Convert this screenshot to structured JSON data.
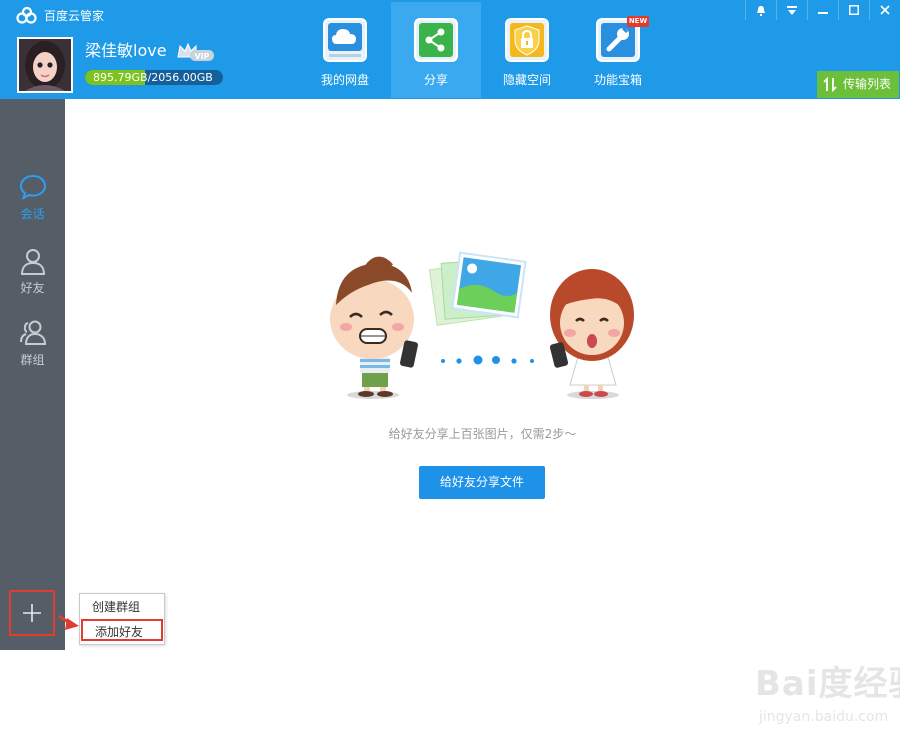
{
  "app": {
    "title": "百度云管家"
  },
  "user": {
    "name": "梁佳敏love",
    "quota_used": "895.79GB",
    "quota_total": "/2056.00GB",
    "quota_fraction": 0.4357
  },
  "nav": {
    "tabs": [
      {
        "label": "我的网盘",
        "icon": "cloud-drive-icon"
      },
      {
        "label": "分享",
        "icon": "share-icon",
        "active": true
      },
      {
        "label": "隐藏空间",
        "icon": "lock-icon"
      },
      {
        "label": "功能宝箱",
        "icon": "toolbox-icon",
        "badge": "NEW"
      }
    ],
    "transfer_label": "传输列表"
  },
  "sidebar": {
    "items": [
      {
        "label": "会话",
        "icon": "chat-icon",
        "active": true
      },
      {
        "label": "好友",
        "icon": "friend-icon"
      },
      {
        "label": "群组",
        "icon": "group-icon"
      }
    ]
  },
  "popup": {
    "items": [
      "创建群组",
      "添加好友"
    ]
  },
  "main": {
    "hint": "给好友分享上百张图片，仅需2步～",
    "share_button": "给好友分享文件"
  },
  "watermark": {
    "text": "Bai度经验",
    "url": "jingyan.baidu.com"
  },
  "colors": {
    "header": "#1e9ae8",
    "sidebar": "#555d66",
    "accent": "#1e92e8",
    "green": "#6cbf38",
    "highlight": "#e23c30"
  }
}
